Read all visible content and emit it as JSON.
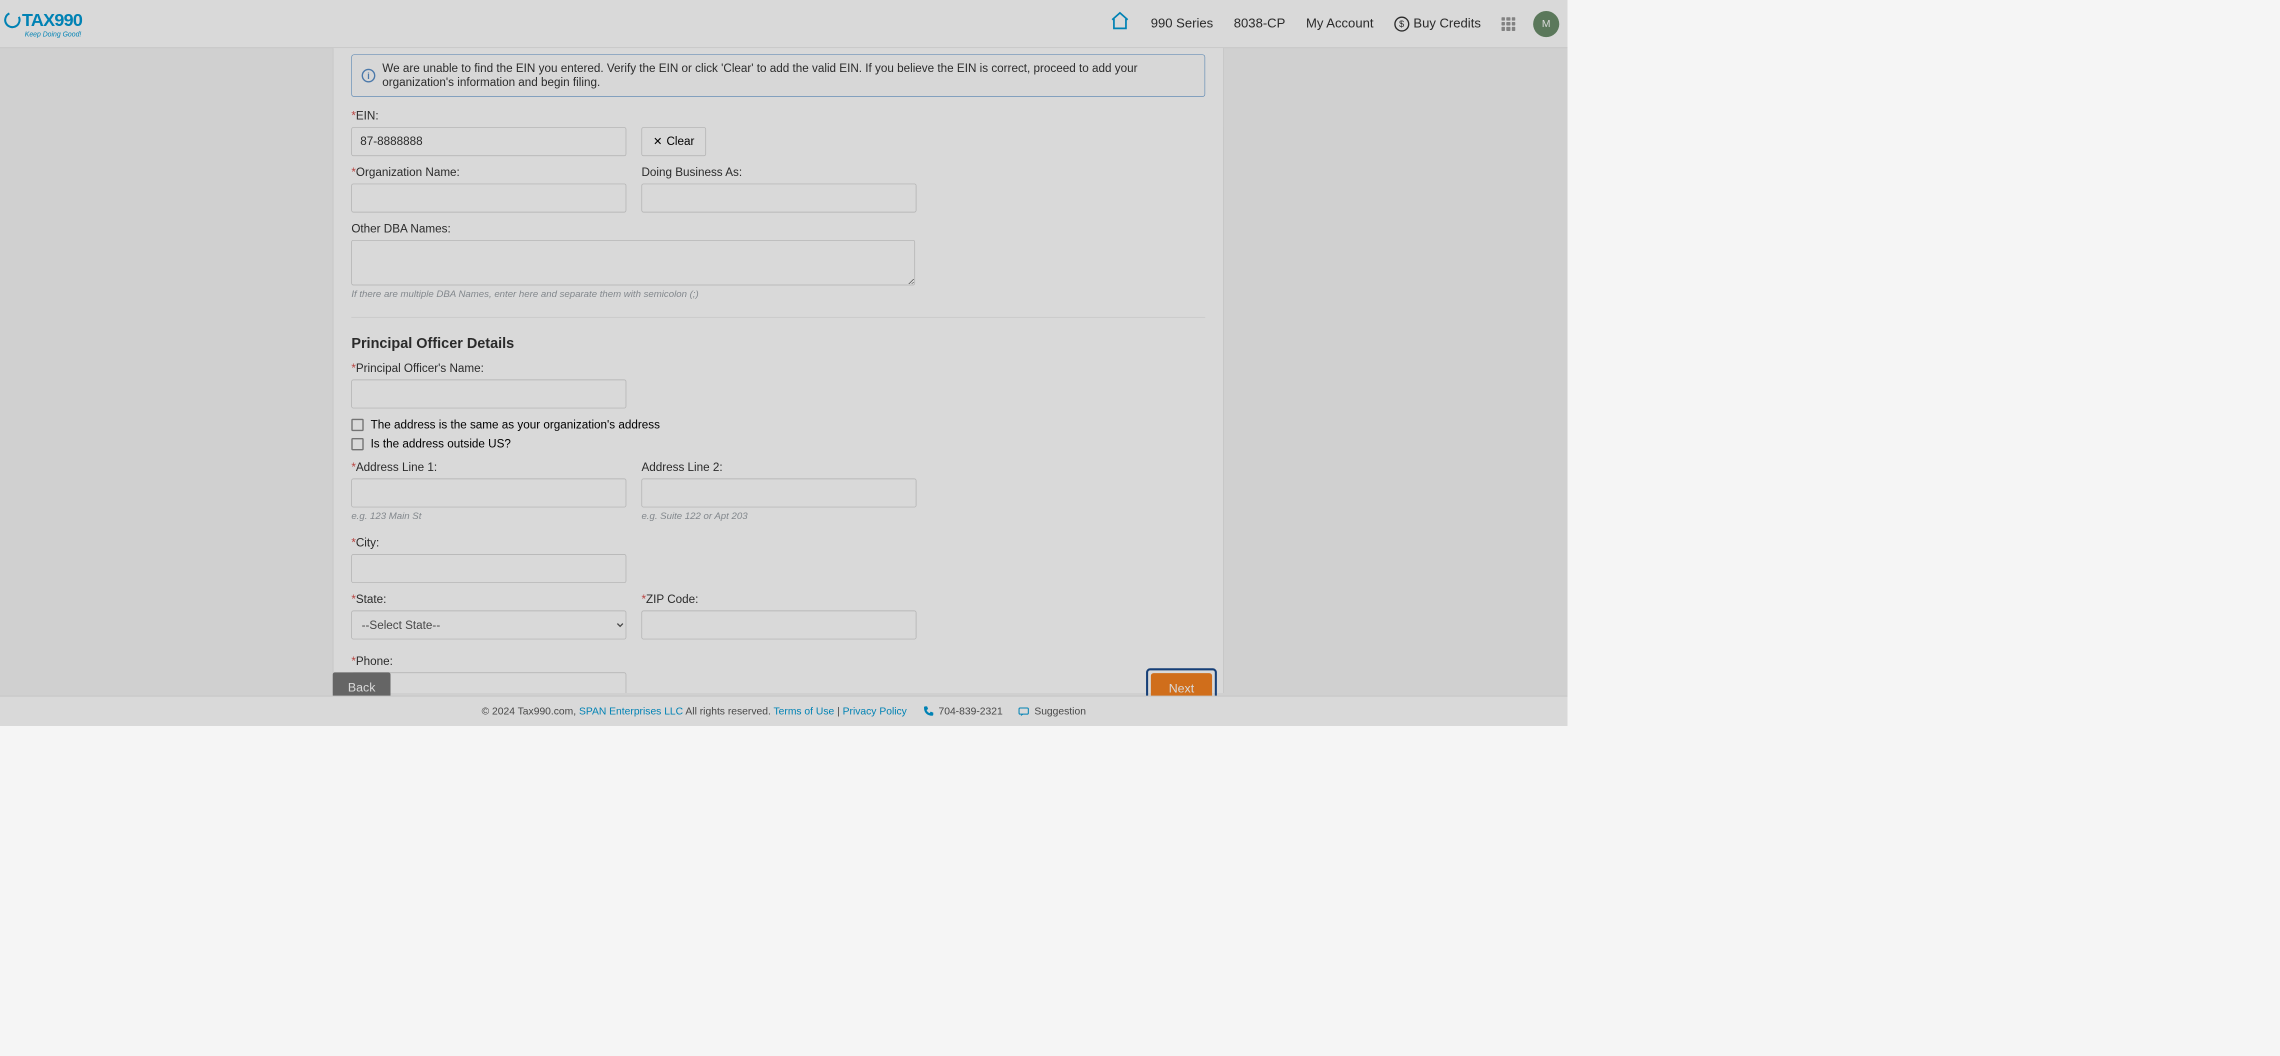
{
  "brand": {
    "name": "TAX990",
    "tagline": "Keep Doing Good!"
  },
  "nav": {
    "series": "990 Series",
    "cp": "8038-CP",
    "account": "My Account",
    "credits": "Buy Credits",
    "avatar": "M"
  },
  "alert": {
    "text": "We are unable to find the EIN you entered. Verify the EIN or click 'Clear' to add the valid EIN. If you believe the EIN is correct, proceed to add your organization's information and begin filing."
  },
  "form": {
    "ein_label": "EIN:",
    "ein_value": "87-8888888",
    "clear_label": "Clear",
    "org_label": "Organization Name:",
    "dba_label": "Doing Business As:",
    "other_dba_label": "Other DBA Names:",
    "other_dba_hint": "If there are multiple DBA Names, enter here and separate them with semicolon (;)",
    "officer_section": "Principal Officer Details",
    "officer_name_label": "Principal Officer's Name:",
    "same_addr_label": "The address is the same as your organization's address",
    "outside_us_label": "Is the address outside US?",
    "addr1_label": "Address Line 1:",
    "addr1_hint": "e.g. 123 Main St",
    "addr2_label": "Address Line 2:",
    "addr2_hint": "e.g. Suite 122 or Apt 203",
    "city_label": "City:",
    "state_label": "State:",
    "state_value": "--Select State--",
    "zip_label": "ZIP Code:",
    "phone_label": "Phone:"
  },
  "nav_buttons": {
    "back": "Back",
    "next": "Next"
  },
  "footer": {
    "copyright": "© 2024 Tax990.com, ",
    "company": "SPAN Enterprises LLC",
    "rights": " All rights reserved. ",
    "terms": "Terms of Use",
    "sep": " | ",
    "privacy": "Privacy Policy",
    "phone": "704-839-2321",
    "suggestion": "Suggestion"
  }
}
